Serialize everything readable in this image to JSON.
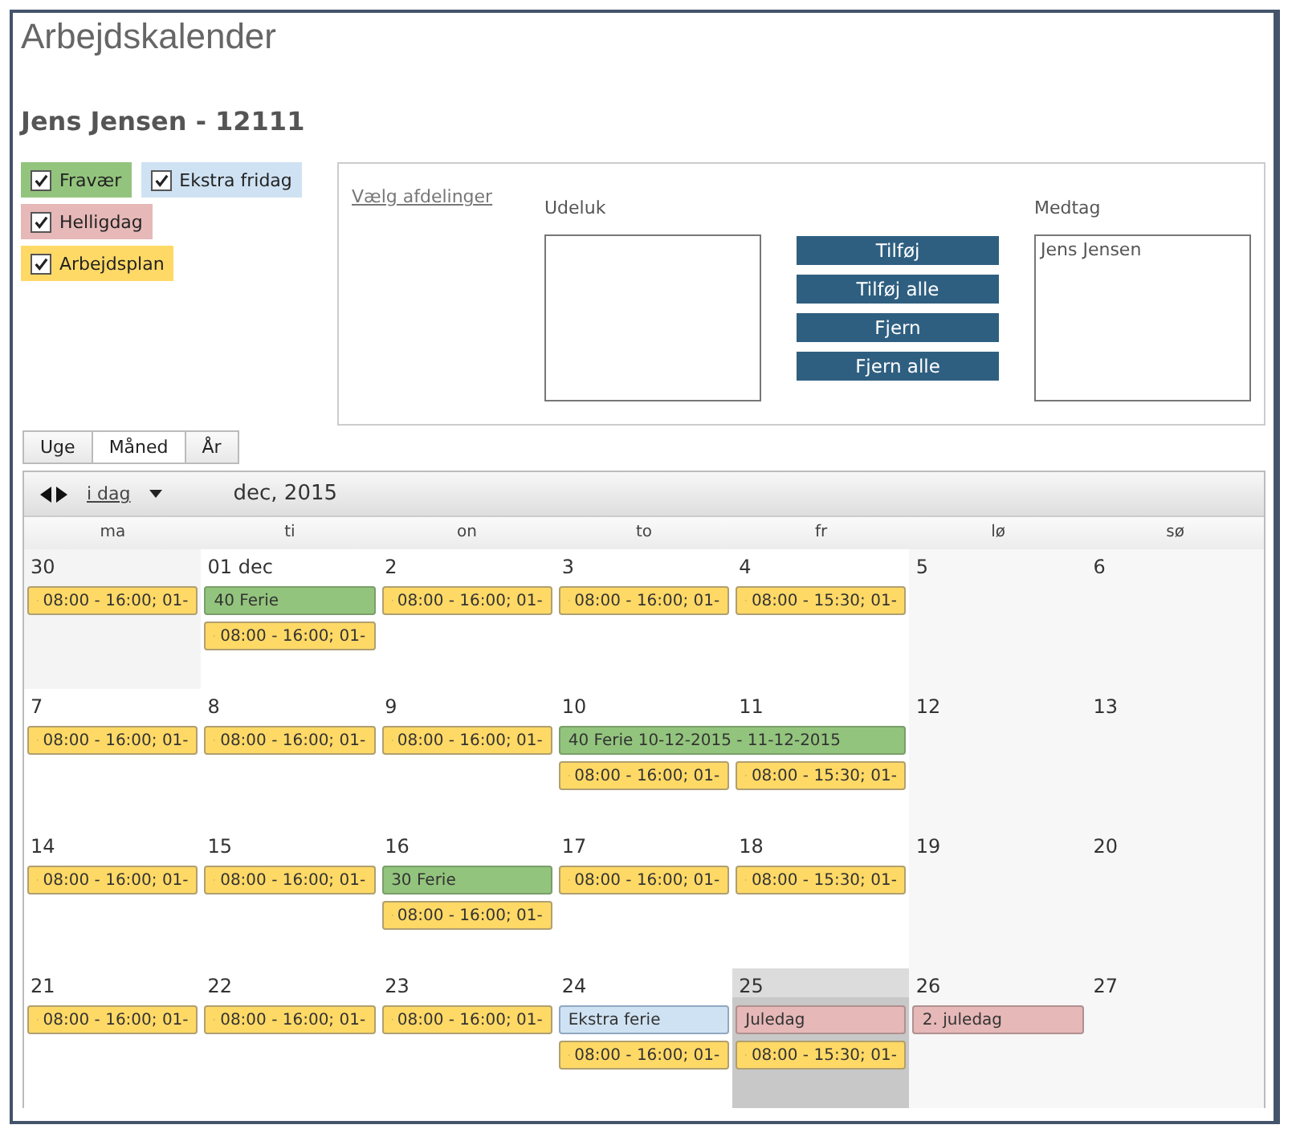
{
  "title": "Arbejdskalender",
  "employee": "Jens Jensen - 12111",
  "legend": [
    {
      "label": "Fravær",
      "checked": true,
      "color": "#93c47d"
    },
    {
      "label": "Ekstra fridag",
      "checked": true,
      "color": "#cfe2f3"
    },
    {
      "label": "Helligdag",
      "checked": true,
      "color": "#e6b8b8"
    },
    {
      "label": "Arbejdsplan",
      "checked": true,
      "color": "#ffd966"
    }
  ],
  "department_panel": {
    "link": "Vælg afdelinger",
    "exclude_label": "Udeluk",
    "include_label": "Medtag",
    "include_items": [
      "Jens Jensen"
    ],
    "buttons": [
      "Tilføj",
      "Tilføj alle",
      "Fjern",
      "Fjern alle"
    ]
  },
  "view_tabs": [
    {
      "label": "Uge",
      "selected": false
    },
    {
      "label": "Måned",
      "selected": true
    },
    {
      "label": "År",
      "selected": false
    }
  ],
  "toolbar": {
    "today_link": "i dag",
    "period": "dec, 2015"
  },
  "weekdays": [
    "ma",
    "ti",
    "on",
    "to",
    "fr",
    "lø",
    "sø"
  ],
  "weeks": [
    {
      "days": [
        {
          "label": "30",
          "kind": "other_month",
          "events": [
            {
              "kind": "work",
              "text": "08:00 - 16:00; 01-"
            }
          ]
        },
        {
          "label": "01 dec",
          "kind": "weekday",
          "events": [
            {
              "kind": "absence",
              "text": "40 Ferie"
            },
            {
              "kind": "work",
              "text": "08:00 - 16:00; 01-"
            }
          ]
        },
        {
          "label": "2",
          "kind": "weekday",
          "events": [
            {
              "kind": "work",
              "text": "08:00 - 16:00; 01-"
            }
          ]
        },
        {
          "label": "3",
          "kind": "weekday",
          "events": [
            {
              "kind": "work",
              "text": "08:00 - 16:00; 01-"
            }
          ]
        },
        {
          "label": "4",
          "kind": "weekday",
          "events": [
            {
              "kind": "work",
              "text": "08:00 - 15:30; 01-"
            }
          ]
        },
        {
          "label": "5",
          "kind": "weekend"
        },
        {
          "label": "6",
          "kind": "weekend"
        }
      ]
    },
    {
      "days": [
        {
          "label": "7",
          "kind": "weekday",
          "events": [
            {
              "kind": "work",
              "text": "08:00 - 16:00; 01-"
            }
          ]
        },
        {
          "label": "8",
          "kind": "weekday",
          "events": [
            {
              "kind": "work",
              "text": "08:00 - 16:00; 01-"
            }
          ]
        },
        {
          "label": "9",
          "kind": "weekday",
          "events": [
            {
              "kind": "work",
              "text": "08:00 - 16:00; 01-"
            }
          ]
        },
        {
          "label": "10",
          "kind": "weekday",
          "events": [
            {
              "kind": "absence",
              "text": "40 Ferie 10-12-2015 - 11-12-2015",
              "spans_next_day": true
            },
            {
              "kind": "work",
              "text": "08:00 - 16:00; 01-"
            }
          ]
        },
        {
          "label": "11",
          "kind": "weekday",
          "events": [
            {
              "kind": "work",
              "text": "08:00 - 15:30; 01-"
            }
          ]
        },
        {
          "label": "12",
          "kind": "weekend"
        },
        {
          "label": "13",
          "kind": "weekend"
        }
      ]
    },
    {
      "days": [
        {
          "label": "14",
          "kind": "weekday",
          "events": [
            {
              "kind": "work",
              "text": "08:00 - 16:00; 01-"
            }
          ]
        },
        {
          "label": "15",
          "kind": "weekday",
          "events": [
            {
              "kind": "work",
              "text": "08:00 - 16:00; 01-"
            }
          ]
        },
        {
          "label": "16",
          "kind": "weekday",
          "events": [
            {
              "kind": "absence",
              "text": "30 Ferie"
            },
            {
              "kind": "work",
              "text": "08:00 - 16:00; 01-"
            }
          ]
        },
        {
          "label": "17",
          "kind": "weekday",
          "events": [
            {
              "kind": "work",
              "text": "08:00 - 16:00; 01-"
            }
          ]
        },
        {
          "label": "18",
          "kind": "weekday",
          "events": [
            {
              "kind": "work",
              "text": "08:00 - 15:30; 01-"
            }
          ]
        },
        {
          "label": "19",
          "kind": "weekend"
        },
        {
          "label": "20",
          "kind": "weekend"
        }
      ]
    },
    {
      "days": [
        {
          "label": "21",
          "kind": "weekday",
          "events": [
            {
              "kind": "work",
              "text": "08:00 - 16:00; 01-"
            }
          ]
        },
        {
          "label": "22",
          "kind": "weekday",
          "events": [
            {
              "kind": "work",
              "text": "08:00 - 16:00; 01-"
            }
          ]
        },
        {
          "label": "23",
          "kind": "weekday",
          "events": [
            {
              "kind": "work",
              "text": "08:00 - 16:00; 01-"
            }
          ]
        },
        {
          "label": "24",
          "kind": "weekday",
          "events": [
            {
              "kind": "extra",
              "text": "Ekstra ferie"
            },
            {
              "kind": "work",
              "text": "08:00 - 16:00; 01-"
            }
          ]
        },
        {
          "label": "25",
          "kind": "today",
          "events": [
            {
              "kind": "holiday",
              "text": "Juledag"
            },
            {
              "kind": "work",
              "text": "08:00 - 15:30; 01-"
            }
          ]
        },
        {
          "label": "26",
          "kind": "weekend",
          "events": [
            {
              "kind": "holiday",
              "text": "2. juledag"
            }
          ]
        },
        {
          "label": "27",
          "kind": "weekend"
        }
      ]
    }
  ]
}
